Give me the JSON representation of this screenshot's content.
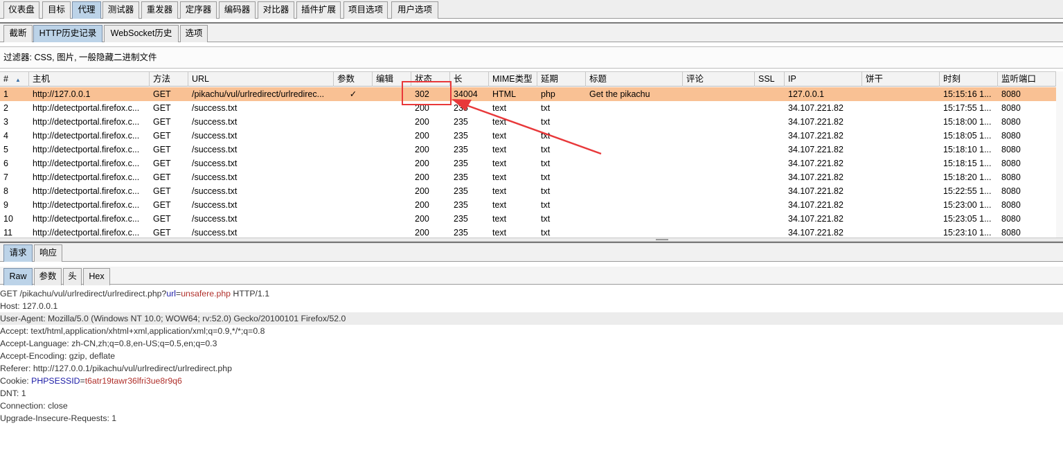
{
  "main_tabs": [
    "仪表盘",
    "目标",
    "代理",
    "测试器",
    "重发器",
    "定序器",
    "编码器",
    "对比器",
    "插件扩展",
    "项目选项",
    "用户选项"
  ],
  "proxy_tabs": [
    "截断",
    "HTTP历史记录",
    "WebSocket历史",
    "选项"
  ],
  "filter_text": "过滤器: CSS, 图片, 一般隐藏二进制文件",
  "columns": [
    "#",
    "主机",
    "方法",
    "URL",
    "参数",
    "编辑",
    "状态",
    "长",
    "MIME类型",
    "延期",
    "标题",
    "评论",
    "SSL",
    "IP",
    "饼干",
    "时刻",
    "监听端口"
  ],
  "rows": [
    {
      "num": "1",
      "host": "http://127.0.0.1",
      "method": "GET",
      "url": "/pikachu/vul/urlredirect/urlredirec...",
      "params": "✓",
      "status": "302",
      "length": "34004",
      "mime": "HTML",
      "ext": "php",
      "title": "Get the pikachu",
      "ip": "127.0.0.1",
      "time": "15:15:16 1...",
      "port": "8080"
    },
    {
      "num": "2",
      "host": "http://detectportal.firefox.c...",
      "method": "GET",
      "url": "/success.txt",
      "params": "",
      "status": "200",
      "length": "235",
      "mime": "text",
      "ext": "txt",
      "title": "",
      "ip": "34.107.221.82",
      "time": "15:17:55 1...",
      "port": "8080"
    },
    {
      "num": "3",
      "host": "http://detectportal.firefox.c...",
      "method": "GET",
      "url": "/success.txt",
      "params": "",
      "status": "200",
      "length": "235",
      "mime": "text",
      "ext": "txt",
      "title": "",
      "ip": "34.107.221.82",
      "time": "15:18:00 1...",
      "port": "8080"
    },
    {
      "num": "4",
      "host": "http://detectportal.firefox.c...",
      "method": "GET",
      "url": "/success.txt",
      "params": "",
      "status": "200",
      "length": "235",
      "mime": "text",
      "ext": "txt",
      "title": "",
      "ip": "34.107.221.82",
      "time": "15:18:05 1...",
      "port": "8080"
    },
    {
      "num": "5",
      "host": "http://detectportal.firefox.c...",
      "method": "GET",
      "url": "/success.txt",
      "params": "",
      "status": "200",
      "length": "235",
      "mime": "text",
      "ext": "txt",
      "title": "",
      "ip": "34.107.221.82",
      "time": "15:18:10 1...",
      "port": "8080"
    },
    {
      "num": "6",
      "host": "http://detectportal.firefox.c...",
      "method": "GET",
      "url": "/success.txt",
      "params": "",
      "status": "200",
      "length": "235",
      "mime": "text",
      "ext": "txt",
      "title": "",
      "ip": "34.107.221.82",
      "time": "15:18:15 1...",
      "port": "8080"
    },
    {
      "num": "7",
      "host": "http://detectportal.firefox.c...",
      "method": "GET",
      "url": "/success.txt",
      "params": "",
      "status": "200",
      "length": "235",
      "mime": "text",
      "ext": "txt",
      "title": "",
      "ip": "34.107.221.82",
      "time": "15:18:20 1...",
      "port": "8080"
    },
    {
      "num": "8",
      "host": "http://detectportal.firefox.c...",
      "method": "GET",
      "url": "/success.txt",
      "params": "",
      "status": "200",
      "length": "235",
      "mime": "text",
      "ext": "txt",
      "title": "",
      "ip": "34.107.221.82",
      "time": "15:22:55 1...",
      "port": "8080"
    },
    {
      "num": "9",
      "host": "http://detectportal.firefox.c...",
      "method": "GET",
      "url": "/success.txt",
      "params": "",
      "status": "200",
      "length": "235",
      "mime": "text",
      "ext": "txt",
      "title": "",
      "ip": "34.107.221.82",
      "time": "15:23:00 1...",
      "port": "8080"
    },
    {
      "num": "10",
      "host": "http://detectportal.firefox.c...",
      "method": "GET",
      "url": "/success.txt",
      "params": "",
      "status": "200",
      "length": "235",
      "mime": "text",
      "ext": "txt",
      "title": "",
      "ip": "34.107.221.82",
      "time": "15:23:05 1...",
      "port": "8080"
    },
    {
      "num": "11",
      "host": "http://detectportal.firefox.c...",
      "method": "GET",
      "url": "/success.txt",
      "params": "",
      "status": "200",
      "length": "235",
      "mime": "text",
      "ext": "txt",
      "title": "",
      "ip": "34.107.221.82",
      "time": "15:23:10 1...",
      "port": "8080"
    }
  ],
  "message_tabs": [
    "请求",
    "响应"
  ],
  "view_tabs": [
    "Raw",
    "参数",
    "头",
    "Hex"
  ],
  "request_lines": [
    {
      "segments": [
        {
          "t": "GET /pikachu/vul/urlredirect/urlredirect.php?",
          "c": ""
        },
        {
          "t": "url",
          "c": "blue"
        },
        {
          "t": "=",
          "c": ""
        },
        {
          "t": "unsafere.php",
          "c": "red"
        },
        {
          "t": " HTTP/1.1",
          "c": ""
        }
      ]
    },
    {
      "segments": [
        {
          "t": "Host: 127.0.0.1",
          "c": ""
        }
      ]
    },
    {
      "segments": [
        {
          "t": "User-Agent: Mozilla/5.0 (Windows NT 10.0; WOW64; rv:52.0) Gecko/20100101 Firefox/52.0",
          "c": ""
        }
      ]
    },
    {
      "segments": [
        {
          "t": "Accept: text/html,application/xhtml+xml,application/xml;q=0.9,*/*;q=0.8",
          "c": ""
        }
      ]
    },
    {
      "segments": [
        {
          "t": "Accept-Language: zh-CN,zh;q=0.8,en-US;q=0.5,en;q=0.3",
          "c": ""
        }
      ]
    },
    {
      "segments": [
        {
          "t": "Accept-Encoding: gzip, deflate",
          "c": ""
        }
      ]
    },
    {
      "segments": [
        {
          "t": "Referer: http://127.0.0.1/pikachu/vul/urlredirect/urlredirect.php",
          "c": ""
        }
      ]
    },
    {
      "segments": [
        {
          "t": "Cookie: ",
          "c": ""
        },
        {
          "t": "PHPSESSID",
          "c": "blue"
        },
        {
          "t": "=",
          "c": ""
        },
        {
          "t": "t6atr19tawr36lfri3ue8r9q6",
          "c": "red"
        }
      ]
    },
    {
      "segments": [
        {
          "t": "DNT: 1",
          "c": ""
        }
      ]
    },
    {
      "segments": [
        {
          "t": "Connection: close",
          "c": ""
        }
      ]
    },
    {
      "segments": [
        {
          "t": "Upgrade-Insecure-Requests: 1",
          "c": ""
        }
      ]
    }
  ],
  "colors": {
    "selected_row": "#f9c194",
    "active_tab": "#bcd3e8",
    "annotation": "#e8383a",
    "param_name": "#1a1aa6",
    "param_value": "#b0302b"
  }
}
